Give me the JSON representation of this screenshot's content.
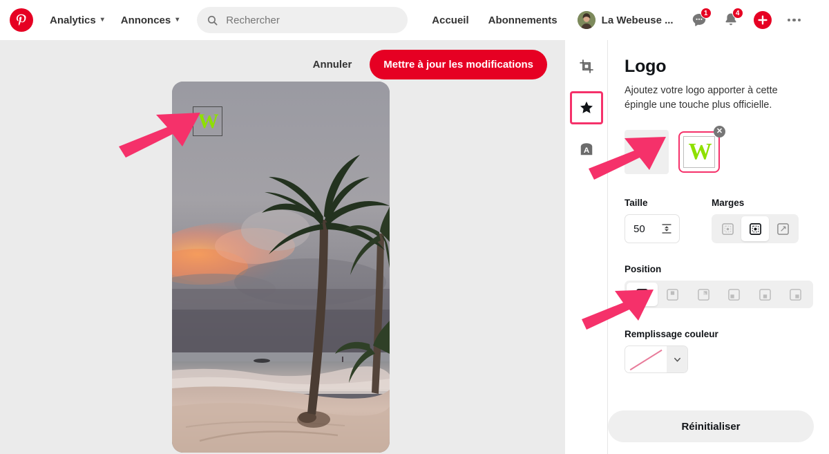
{
  "header": {
    "brand_icon": "pinterest-logo-icon",
    "nav": [
      {
        "label": "Analytics",
        "icon": "chevron-down-icon"
      },
      {
        "label": "Annonces",
        "icon": "chevron-down-icon"
      }
    ],
    "search": {
      "icon": "search-icon",
      "placeholder": "Rechercher",
      "value": ""
    },
    "links": [
      {
        "label": "Accueil"
      },
      {
        "label": "Abonnements"
      }
    ],
    "user": {
      "name": "La Webeuse ...",
      "avatar_icon": "avatar"
    },
    "actions": [
      {
        "icon": "messages-icon",
        "badge": "1"
      },
      {
        "icon": "bell-icon",
        "badge": "4"
      },
      {
        "icon": "plus-icon",
        "badge": ""
      },
      {
        "icon": "more-options-icon",
        "badge": ""
      }
    ]
  },
  "canvas": {
    "cancel_label": "Annuler",
    "update_label": "Mettre à jour les modifications",
    "photo_alt": "beach-palm-trees-sunset-photo",
    "overlay_logo_text": "W"
  },
  "tool_rail": [
    {
      "name": "crop-tool",
      "icon": "crop-icon",
      "selected": false
    },
    {
      "name": "logo-tool",
      "icon": "star-icon",
      "selected": true
    },
    {
      "name": "text-tool",
      "icon": "text-a-icon",
      "selected": false
    }
  ],
  "panel": {
    "title": "Logo",
    "description": "Ajoutez votre logo apporter à cette épingle une touche plus officielle.",
    "add_logo_icon": "plus-icon",
    "logo_thumb_text": "W",
    "logo_thumb_close_icon": "close-icon",
    "size": {
      "label": "Taille",
      "value": "50",
      "icon": "height-resize-icon"
    },
    "margins": {
      "label": "Marges",
      "options": [
        {
          "name": "margin-small",
          "icon": "margin-small-icon",
          "selected": false
        },
        {
          "name": "margin-medium",
          "icon": "margin-medium-icon",
          "selected": true
        },
        {
          "name": "margin-large",
          "icon": "margin-large-icon",
          "selected": false
        }
      ]
    },
    "position": {
      "label": "Position",
      "options": [
        {
          "name": "position-top-left",
          "icon": "position-top-left-icon",
          "selected": true
        },
        {
          "name": "position-top-center",
          "icon": "position-top-center-icon",
          "selected": false
        },
        {
          "name": "position-top-right",
          "icon": "position-top-right-icon",
          "selected": false
        },
        {
          "name": "position-bottom-left",
          "icon": "position-bottom-left-icon",
          "selected": false
        },
        {
          "name": "position-bottom-center",
          "icon": "position-bottom-center-icon",
          "selected": false
        },
        {
          "name": "position-bottom-right",
          "icon": "position-bottom-right-icon",
          "selected": false
        }
      ]
    },
    "fill_color": {
      "label": "Remplissage couleur",
      "value": "none",
      "caret_icon": "chevron-down-icon"
    },
    "reset_label": "Réinitialiser"
  },
  "annotations": {
    "arrow_color": "#f5316a",
    "arrows": [
      {
        "name": "arrow-to-photo-logo"
      },
      {
        "name": "arrow-to-add-logo"
      },
      {
        "name": "arrow-to-position"
      }
    ],
    "highlight_box": {
      "name": "highlight-logo-tool",
      "color": "#f5316a"
    }
  },
  "colors": {
    "brand_red": "#e60023",
    "annotation_pink": "#f5316a",
    "canvas_bg": "#ebebeb",
    "logo_green": "#8ee000"
  }
}
